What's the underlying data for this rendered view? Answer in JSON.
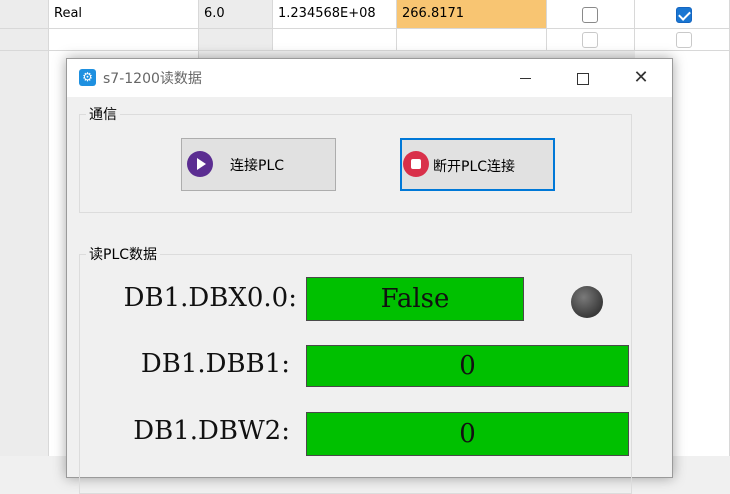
{
  "background_table": {
    "row1": {
      "type": "Real",
      "offset": "6.0",
      "value": "1.234568E+08",
      "monitor_value": "266.8171",
      "checkbox1_checked": false,
      "checkbox2_checked": true
    }
  },
  "window": {
    "title": "s7-1200读数据",
    "icon": "gear-icon"
  },
  "comm_group": {
    "label": "通信",
    "connect_button": "连接PLC",
    "disconnect_button": "断开PLC连接"
  },
  "read_group": {
    "label": "读PLC数据",
    "items": [
      {
        "address": "DB1.DBX0.0:",
        "value": "False"
      },
      {
        "address": "DB1.DBB1:",
        "value": "0"
      },
      {
        "address": "DB1.DBW2:",
        "value": "0"
      }
    ],
    "led_state": "off"
  },
  "colors": {
    "value_background": "#00c000",
    "monitor_highlight": "#f8c572",
    "accent": "#0078d7"
  }
}
